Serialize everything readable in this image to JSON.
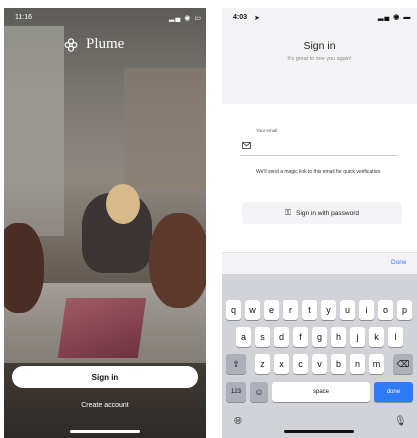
{
  "left_screen": {
    "status_time": "11:16",
    "logo_text": "Plume",
    "sign_in_label": "Sign in",
    "create_account_label": "Create account"
  },
  "right_screen": {
    "status_time": "4:03",
    "title": "Sign in",
    "subtitle": "It's great to see you again!",
    "email_label": "Your email",
    "helper_text": "We'll send a magic link to this email for quick verification.",
    "password_button_label": "Sign in with password",
    "done_label": "Done",
    "keyboard": {
      "row1": [
        "q",
        "w",
        "e",
        "r",
        "t",
        "y",
        "u",
        "i",
        "o",
        "p"
      ],
      "row2": [
        "a",
        "s",
        "d",
        "f",
        "g",
        "h",
        "j",
        "k",
        "l"
      ],
      "row3": [
        "z",
        "x",
        "c",
        "v",
        "b",
        "n",
        "m"
      ],
      "numbers_key": "123",
      "space_key": "space",
      "done_key": "done"
    }
  }
}
